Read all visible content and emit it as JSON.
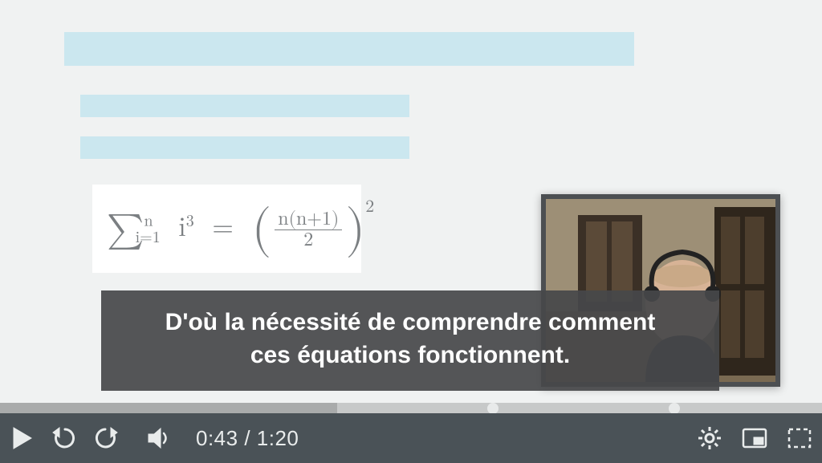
{
  "caption": {
    "line1": "D'où la nécessité de comprendre comment",
    "line2": "ces équations fonctionnent."
  },
  "player": {
    "current_time": "0:43",
    "separator": " / ",
    "duration": "1:20",
    "progress_percent": 41,
    "chapter_markers_percent": [
      60,
      82
    ]
  },
  "equation": {
    "display": "Σᵢ₌₁ⁿ i³ = ( n(n+1) / 2 )²"
  },
  "controls": {
    "play": "play-button",
    "rewind": "rewind-10-button",
    "forward": "forward-10-button",
    "volume": "volume-button",
    "settings": "settings-button",
    "pip": "picture-in-picture-button",
    "fullscreen": "fullscreen-button"
  }
}
